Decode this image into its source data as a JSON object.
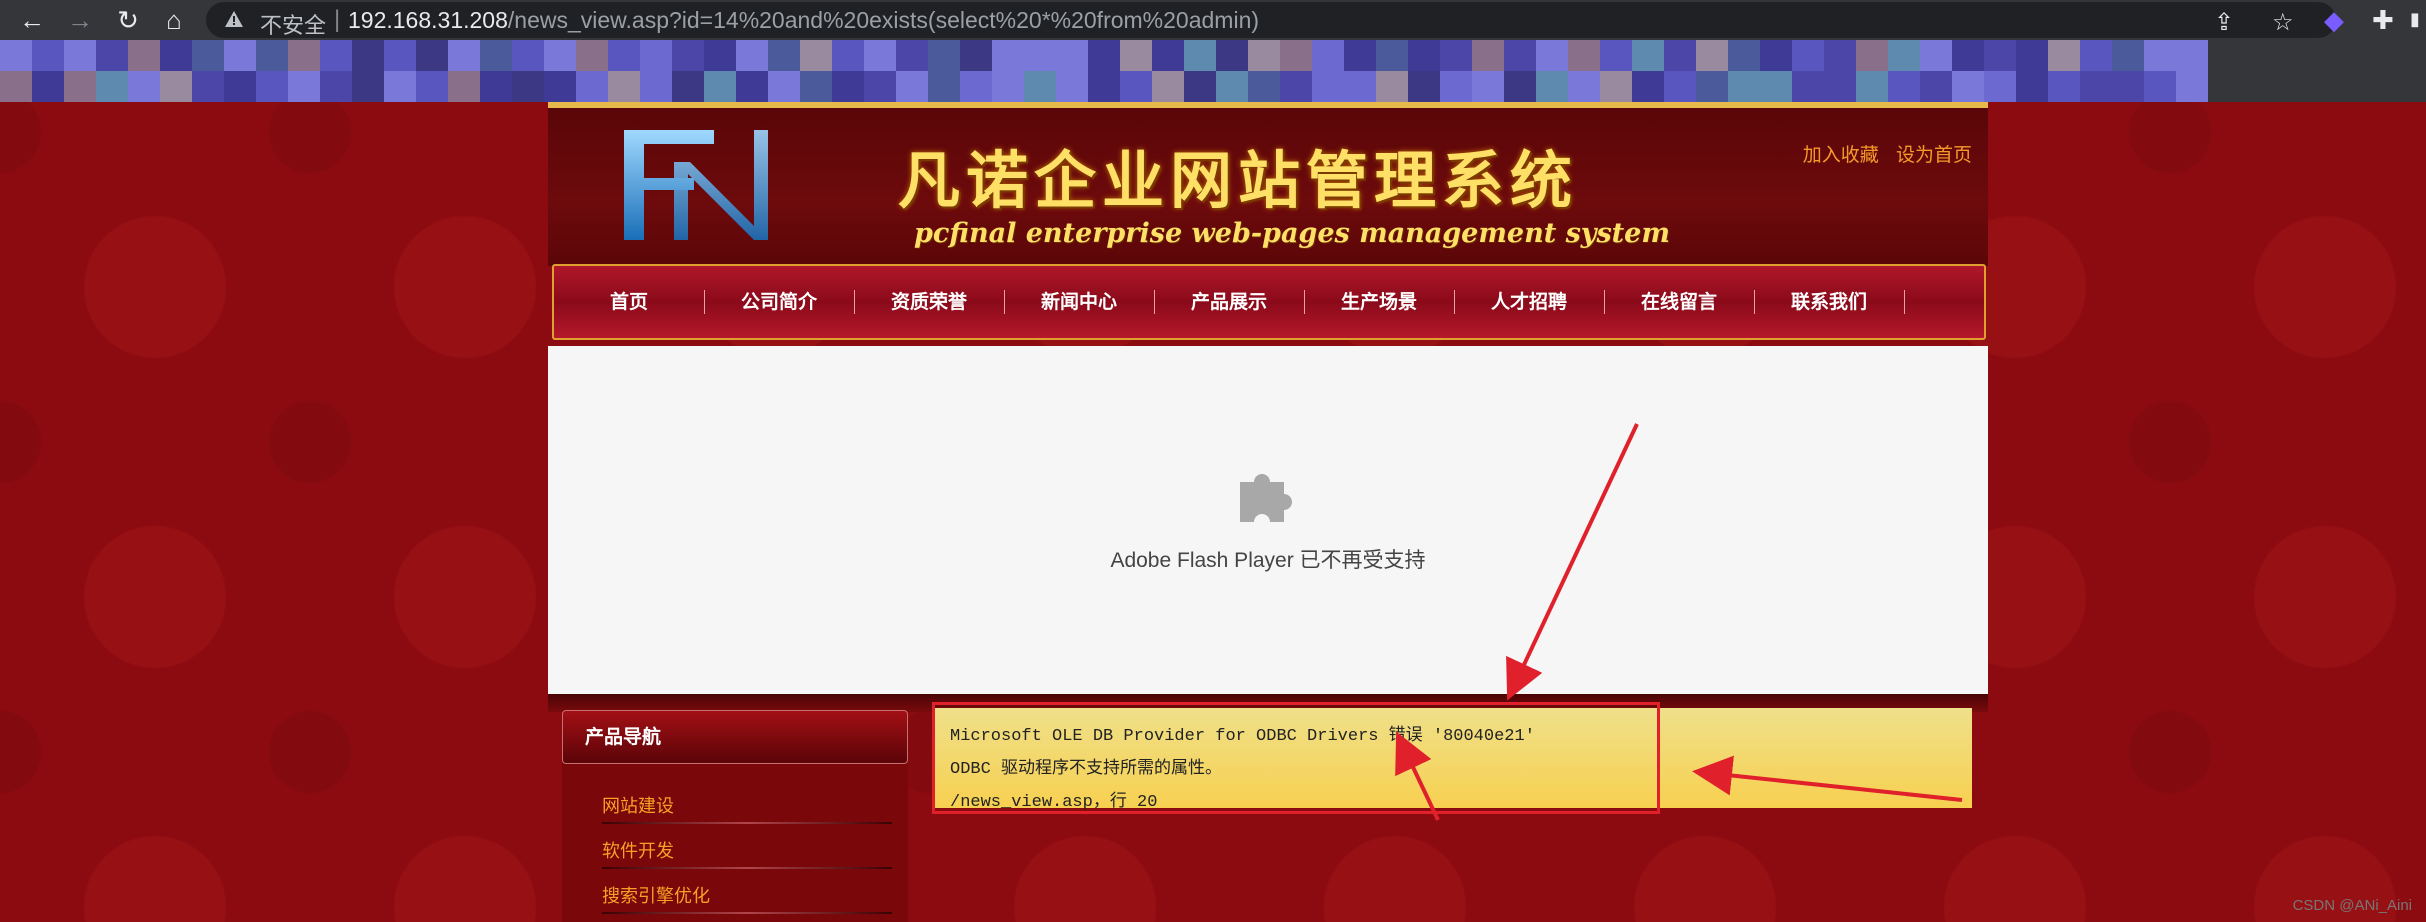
{
  "browser": {
    "security_label": "不安全",
    "separator": "|",
    "url_host": "192.168.31.208",
    "url_path": "/news_view.asp?id=14%20and%20exists(select%20*%20from%20admin)",
    "icons": [
      "back-icon",
      "forward-icon",
      "reload-icon",
      "home-icon",
      "warning-icon",
      "share-icon",
      "star-icon",
      "extension-icon",
      "puzzle-extension-icon",
      "profile-icon"
    ]
  },
  "site": {
    "logo_text": "FN",
    "title_cn": "凡诺企业网站管理系统",
    "title_en": "pcfinal enterprise web-pages management system",
    "top_links": [
      "加入收藏",
      "设为首页"
    ]
  },
  "nav": {
    "items": [
      "首页",
      "公司简介",
      "资质荣誉",
      "新闻中心",
      "产品展示",
      "生产场景",
      "人才招聘",
      "在线留言",
      "联系我们"
    ]
  },
  "flash": {
    "message": "Adobe Flash Player 已不再受支持"
  },
  "sidebar": {
    "heading": "产品导航",
    "items": [
      "网站建设",
      "软件开发",
      "搜索引擎优化"
    ]
  },
  "error": {
    "line1": "Microsoft OLE DB Provider for ODBC Drivers 错误 '80040e21'",
    "line2": "ODBC 驱动程序不支持所需的属性。",
    "line3": "/news_view.asp，行 20"
  },
  "watermark": "CSDN @ANi_Aini",
  "colors": {
    "page_bg": "#8b0b10",
    "gold": "#ffe066",
    "link_orange": "#f59a2a",
    "annotation_red": "#e0202a"
  }
}
